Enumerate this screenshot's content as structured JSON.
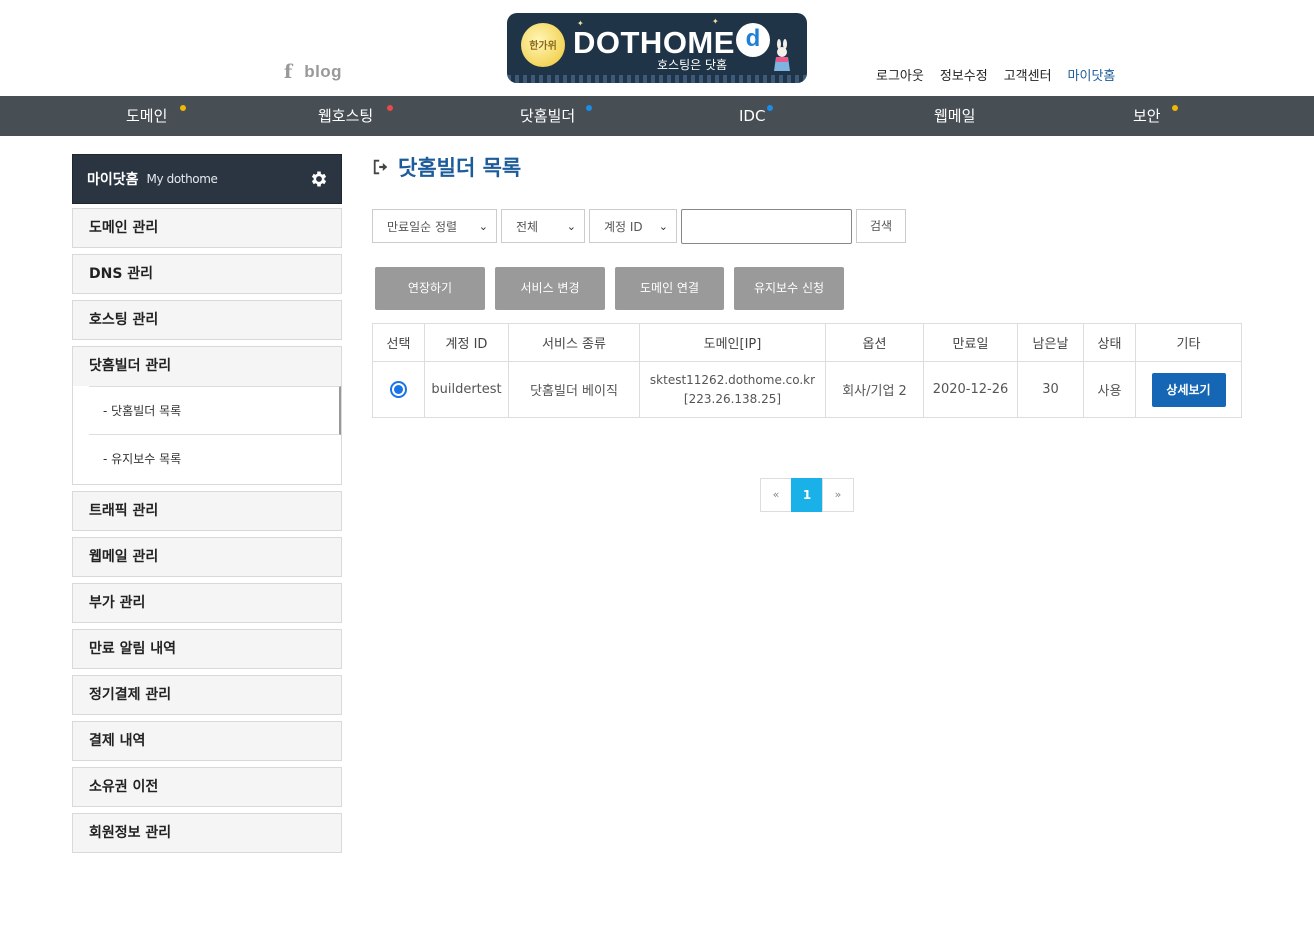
{
  "header": {
    "social": {
      "facebook": "f",
      "blog": "blog"
    },
    "logo": {
      "moon_text": "한가위",
      "brand": "DOTHOME",
      "badge": "d",
      "tagline": "호스팅은 닷홈"
    },
    "top_links": [
      "로그아웃",
      "정보수정",
      "고객센터",
      "마이닷홈"
    ]
  },
  "nav": {
    "items": [
      {
        "label": "도메인",
        "dot": "#f2b705"
      },
      {
        "label": "웹호스팅",
        "dot": "#e84a4a"
      },
      {
        "label": "닷홈빌더",
        "dot": "#1a8de8"
      },
      {
        "label": "IDC",
        "dot": "#1a8de8"
      },
      {
        "label": "웹메일",
        "dot": ""
      },
      {
        "label": "보안",
        "dot": "#f2b705"
      }
    ]
  },
  "sidebar": {
    "head_title": "마이닷홈",
    "head_sub": "My dothome",
    "items_before": [
      "도메인 관리",
      "DNS 관리",
      "호스팅 관리"
    ],
    "group": {
      "title": "닷홈빌더 관리",
      "subs": [
        "- 닷홈빌더 목록",
        "- 유지보수 목록"
      ]
    },
    "items_after": [
      "트래픽 관리",
      "웹메일 관리",
      "부가 관리",
      "만료 알림 내역",
      "정기결제 관리",
      "결제 내역",
      "소유권 이전",
      "회원정보 관리"
    ]
  },
  "main": {
    "title": "닷홈빌더 목록",
    "filters": {
      "sort": "만료일순 정렬",
      "scope": "전체",
      "field": "계정 ID",
      "query": "",
      "search_label": "검색"
    },
    "actions": [
      "연장하기",
      "서비스 변경",
      "도메인 연결",
      "유지보수 신청"
    ],
    "table": {
      "headers": [
        "선택",
        "계정 ID",
        "서비스 종류",
        "도메인[IP]",
        "옵션",
        "만료일",
        "남은날",
        "상태",
        "기타"
      ],
      "rows": [
        {
          "account": "buildertest",
          "service": "닷홈빌더 베이직",
          "domain": "sktest11262.dothome.co.kr",
          "ip": "[223.26.138.25]",
          "option": "회사/기업 2",
          "expires": "2020-12-26",
          "days_left": "30",
          "status": "사용",
          "detail_label": "상세보기"
        }
      ]
    },
    "pager": {
      "prev": "«",
      "current": "1",
      "next": "»"
    }
  },
  "colors": {
    "nav_bg": "#474e54",
    "accent": "#1d5c9a",
    "primary_button": "#1566b5",
    "pager_active": "#1ab0e8"
  }
}
